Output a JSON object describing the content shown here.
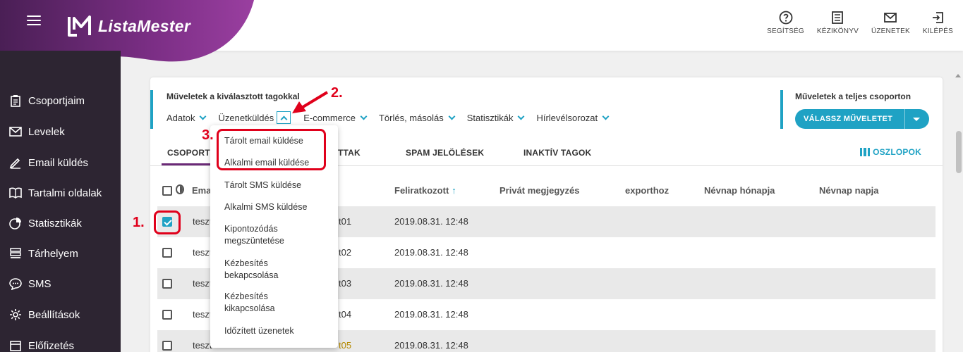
{
  "app": {
    "name": "ListaMester"
  },
  "header": {
    "actions": [
      {
        "label": "SEGÍTSÉG",
        "icon": "help-icon"
      },
      {
        "label": "KÉZIKÖNYV",
        "icon": "book-icon"
      },
      {
        "label": "ÜZENETEK",
        "icon": "mail-icon"
      },
      {
        "label": "KILÉPÉS",
        "icon": "logout-icon"
      }
    ]
  },
  "sidebar": {
    "items": [
      {
        "label": "Csoportjaim",
        "icon": "clipboard-icon"
      },
      {
        "label": "Levelek",
        "icon": "envelope-icon"
      },
      {
        "label": "Email küldés",
        "icon": "pencil-icon"
      },
      {
        "label": "Tartalmi oldalak",
        "icon": "open-book-icon"
      },
      {
        "label": "Statisztikák",
        "icon": "pie-chart-icon"
      },
      {
        "label": "Tárhelyem",
        "icon": "storage-icon"
      },
      {
        "label": "SMS",
        "icon": "chat-icon"
      },
      {
        "label": "Beállítások",
        "icon": "gear-icon"
      },
      {
        "label": "Előfizetés",
        "icon": "subscription-icon"
      }
    ]
  },
  "operations": {
    "title": "Műveletek a kiválasztott tagokkal",
    "menu": [
      "Adatok",
      "Üzenetküldés",
      "E-commerce",
      "Törlés, másolás",
      "Statisztikák",
      "Hírlevélsorozat"
    ],
    "group_title": "Műveletek a teljes csoporton",
    "choose_action": "VÁLASSZ MŰVELETET"
  },
  "tabs": {
    "items": [
      "CSOPORTT",
      "TTAK",
      "SPAM JELÖLÉSEK",
      "INAKTÍV TAGOK"
    ],
    "columns": "OSZLOPOK"
  },
  "table": {
    "headers": {
      "email": "Ema",
      "subscribed": "Feliratkozott",
      "private_note": "Privát megjegyzés",
      "export": "exporthoz",
      "nameday_month": "Névnap hónapja",
      "nameday_day": "Névnap napja"
    },
    "sort_indicator": "↑",
    "rows": [
      {
        "email": "teszt",
        "name": "t01",
        "date": "2019.08.31. 12:48",
        "checked": true
      },
      {
        "email": "teszt",
        "name": "t02",
        "date": "2019.08.31. 12:48",
        "checked": false
      },
      {
        "email": "teszt",
        "name": "t03",
        "date": "2019.08.31. 12:48",
        "checked": false
      },
      {
        "email": "teszt",
        "name": "t04",
        "date": "2019.08.31. 12:48",
        "checked": false
      },
      {
        "email": "teszt",
        "name": "t05",
        "date": "2019.08.31. 12:48",
        "checked": false
      }
    ]
  },
  "dropdown": {
    "items": [
      "Tárolt email küldése",
      "Alkalmi email küldése",
      "Tárolt SMS küldése",
      "Alkalmi SMS küldése",
      "Kipontozódás megszüntetése",
      "Kézbesítés bekapcsolása",
      "Kézbesítés kikapcsolása",
      "Időzített üzenetek"
    ]
  },
  "annotations": {
    "step1": "1.",
    "step2": "2.",
    "step3": "3."
  },
  "colors": {
    "accent": "#1fa2c4",
    "brand_purple": "#6b2a77",
    "sidebar": "#2d2532",
    "annotation": "#e0001b"
  }
}
